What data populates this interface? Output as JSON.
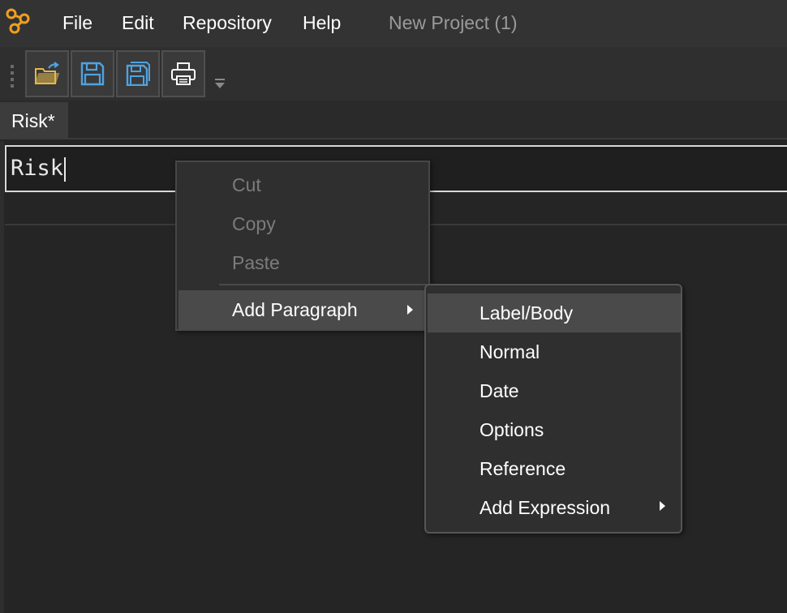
{
  "menubar": {
    "items": [
      {
        "label": "File"
      },
      {
        "label": "Edit"
      },
      {
        "label": "Repository"
      },
      {
        "label": "Help"
      }
    ],
    "project_title": "New Project (1)"
  },
  "toolbar": {
    "buttons": [
      {
        "icon": "open-folder-icon"
      },
      {
        "icon": "save-icon"
      },
      {
        "icon": "save-all-icon"
      },
      {
        "icon": "print-icon"
      }
    ]
  },
  "tabs": [
    {
      "label": "Risk*"
    }
  ],
  "editor": {
    "title_value": "Risk"
  },
  "context_menu": {
    "items": [
      {
        "label": "Cut",
        "enabled": false
      },
      {
        "label": "Copy",
        "enabled": false
      },
      {
        "label": "Paste",
        "enabled": false
      },
      {
        "label": "Add Paragraph",
        "enabled": true,
        "has_submenu": true
      }
    ]
  },
  "submenu": {
    "items": [
      {
        "label": "Label/Body"
      },
      {
        "label": "Normal"
      },
      {
        "label": "Date"
      },
      {
        "label": "Options"
      },
      {
        "label": "Reference"
      },
      {
        "label": "Add Expression",
        "has_submenu": true
      }
    ]
  },
  "colors": {
    "background": "#252525",
    "menubar": "#333333",
    "icon_accent": "#4fa3e0",
    "folder_accent": "#e6b84a",
    "logo_accent": "#f0a020"
  }
}
